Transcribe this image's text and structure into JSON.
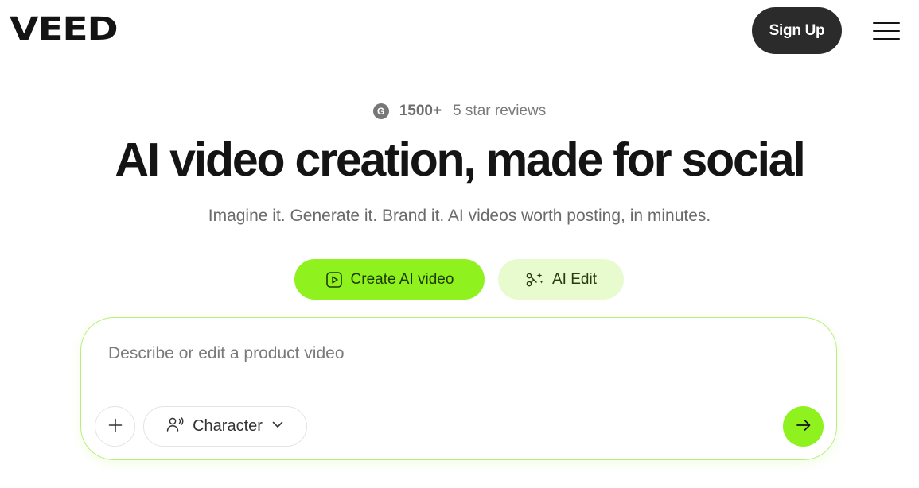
{
  "header": {
    "logo_text": "VEED",
    "signup_label": "Sign Up",
    "menu_icon": "hamburger-menu-icon"
  },
  "rating": {
    "icon": "g2-icon",
    "icon_letter": "G",
    "count": "1500+",
    "text": "5 star reviews"
  },
  "hero": {
    "title": "AI video creation, made for social",
    "subtitle": "Imagine it. Generate it. Brand it. AI videos worth posting, in minutes."
  },
  "modes": [
    {
      "label": "Create AI video",
      "icon": "play-square-icon",
      "selected": true
    },
    {
      "label": "AI Edit",
      "icon": "magic-scissors-icon",
      "selected": false
    }
  ],
  "prompt": {
    "placeholder": "Describe or edit a product video",
    "value": "",
    "add_icon": "plus-icon",
    "character_label": "Character",
    "character_icon": "speaking-person-icon",
    "dropdown_icon": "chevron-down-icon",
    "send_icon": "arrow-right-icon"
  },
  "colors": {
    "accent": "#8ff21f",
    "accent_light": "#e8fbcf",
    "dark": "#2b2b2b",
    "text": "#141414",
    "muted": "#6a6a6a"
  }
}
